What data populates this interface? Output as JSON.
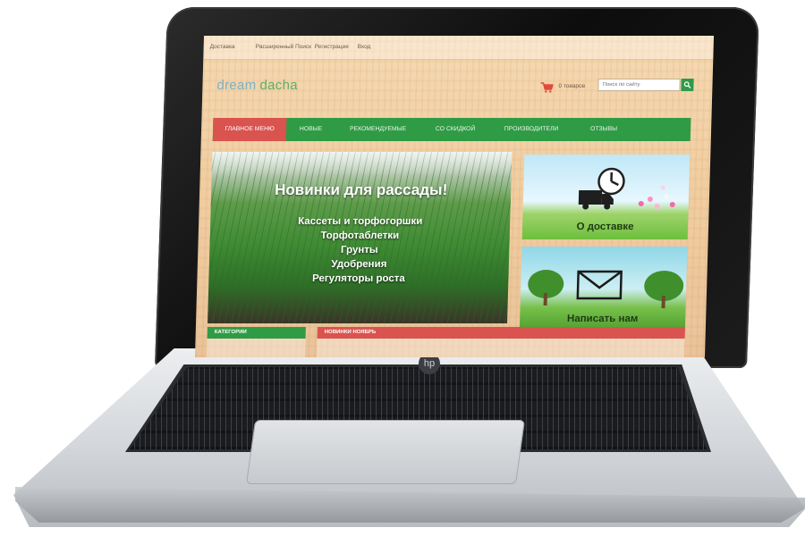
{
  "colors": {
    "menu_green": "#2f9b45",
    "accent_red": "#d9534f",
    "cart_red": "#e04b3c",
    "logo_blue": "#7bb2c6"
  },
  "topnav": {
    "items": [
      "Доставка",
      "Расширенный Поиск",
      "Регистрация",
      "Вход"
    ]
  },
  "header": {
    "logo_part1": "dream",
    "logo_part2": "dacha",
    "cart_icon": "shopping-cart-icon",
    "cart_text": "0 товаров",
    "search_placeholder": "Поиск по сайту",
    "search_icon": "search-icon"
  },
  "menu": {
    "items": [
      "ГЛАВНОЕ МЕНЮ",
      "НОВЫЕ",
      "РЕКОМЕНДУЕМЫЕ",
      "СО СКИДКОЙ",
      "ПРОИЗВОДИТЕЛИ",
      "ОТЗЫВЫ"
    ]
  },
  "banner": {
    "title": "Новинки для рассады!",
    "lines": [
      "Кассеты и торфогоршки",
      "Торфотаблетки",
      "Грунты",
      "Удобрения",
      "Регуляторы роста"
    ]
  },
  "cards": {
    "delivery": {
      "label": "О доставке",
      "icon": "delivery-truck-clock-icon"
    },
    "contact": {
      "label": "Написать нам",
      "icon": "envelope-icon"
    }
  },
  "sections": {
    "categories": "КАТЕГОРИИ",
    "news": "НОВИНКИ НОЯБРЬ"
  },
  "brand_mark": "hp-logo-icon"
}
